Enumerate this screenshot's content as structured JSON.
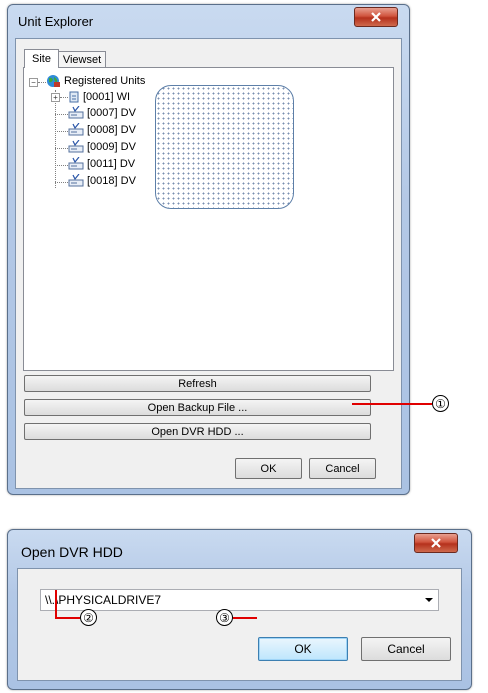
{
  "unit_explorer": {
    "title": "Unit Explorer",
    "tabs": [
      {
        "label": "Site",
        "active": true
      },
      {
        "label": "Viewset",
        "active": false
      }
    ],
    "tree": {
      "root": "Registered Units",
      "children": [
        {
          "id": "[0001]",
          "label": "[0001] WI",
          "icon": "network-device-icon",
          "expandable": true
        },
        {
          "id": "[0007]",
          "label": "[0007] DV",
          "icon": "dvr-icon"
        },
        {
          "id": "[0008]",
          "label": "[0008] DV",
          "icon": "dvr-icon"
        },
        {
          "id": "[0009]",
          "label": "[0009] DV",
          "icon": "dvr-icon"
        },
        {
          "id": "[0011]",
          "label": "[0011] DV",
          "icon": "dvr-icon"
        },
        {
          "id": "[0018]",
          "label": "[0018] DV",
          "icon": "dvr-icon"
        }
      ]
    },
    "buttons": {
      "refresh": "Refresh",
      "open_backup": "Open Backup File ...",
      "open_dvr_hdd": "Open DVR HDD ...",
      "ok": "OK",
      "cancel": "Cancel"
    }
  },
  "open_dvr_hdd": {
    "title": "Open DVR HDD",
    "drive_value": "\\\\.\\PHYSICALDRIVE7",
    "buttons": {
      "ok": "OK",
      "cancel": "Cancel"
    }
  },
  "callouts": [
    "①",
    "②",
    "③"
  ],
  "colors": {
    "callout_line": "#e00000",
    "title_bar": "#b3c8e6",
    "close_button": "#c9452e"
  }
}
